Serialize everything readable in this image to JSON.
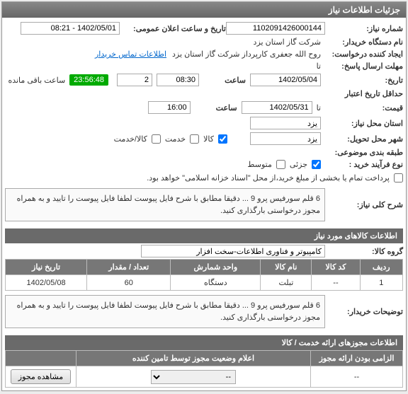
{
  "header": {
    "title": "جزئیات اطلاعات نیاز"
  },
  "info": {
    "req_no_label": "شماره نیاز:",
    "req_no": "1102091426000144",
    "announce_label": "تاریخ و ساعت اعلان عمومی:",
    "announce": "1402/05/01 - 08:21",
    "buyer_label": "نام دستگاه خریدار:",
    "buyer": "شرکت گاز استان یزد",
    "creator_label": "ایجاد کننده درخواست:",
    "creator": "روح الله جعفری کارپرداز شرکت گاز استان یزد",
    "contact_link": "اطلاعات تماس خریدار",
    "deadline_label": "مهلت ارسال پاسخ:",
    "deadline_word": "تا",
    "history_label": "تاریخ:",
    "deadline_date": "1402/05/04",
    "time_label": "ساعت",
    "deadline_time": "08:30",
    "days_remain": "2",
    "remain_badge": "23:56:48",
    "remain_text": "ساعت باقی مانده",
    "min_valid_label": "حداقل تاریخ اعتبار",
    "price_label": "قیمت:",
    "price_word": "تا",
    "valid_date": "1402/05/31",
    "valid_time": "16:00",
    "req_loc_label": "استان محل نیاز:",
    "req_loc": "یزد",
    "deliv_loc_label": "شهر محل تحویل:",
    "deliv_loc": "یزد",
    "cat_label": "طبقه بندی موضوعی:",
    "chk_goods": "کالا",
    "chk_service": "خدمت",
    "chk_goods_service": "کالا/خدمت",
    "proc_label": "نوع فرآیند خرید :",
    "chk_partial": "جزئی",
    "chk_mid": "متوسط",
    "pay_note": "پرداخت تمام یا بخشی از مبلغ خرید،از محل \"اسناد خزانه اسلامی\" خواهد بود."
  },
  "need": {
    "title_label": "شرح کلی نیاز:",
    "title_text": "6 قلم سورفیس پرو 9 ... دقیقا مطابق با شرح فایل پیوست لطفا فایل پیوست را تایید و به همراه مجوز درخواستی بارگذاری کنید."
  },
  "goods": {
    "section": "اطلاعات کالاهای مورد نیاز",
    "group_label": "گروه کالا:",
    "group_value": "کامپیوتر و فناوری اطلاعات-سخت افزار",
    "cols": {
      "row": "ردیف",
      "code": "کد کالا",
      "name": "نام کالا",
      "unit": "واحد شمارش",
      "qty": "تعداد / مقدار",
      "date": "تاریخ نیاز"
    },
    "rows": [
      {
        "row": "1",
        "code": "--",
        "name": "تبلت",
        "unit": "دستگاه",
        "qty": "60",
        "date": "1402/05/08"
      }
    ],
    "buyer_note_label": "توضیحات خریدار:",
    "buyer_note": "6 قلم سورفیس پرو 9 ... دقیقا مطابق با شرح فایل پیوست لطفا فایل پیوست را تایید و به همراه مجوز درخواستی بارگذاری کنید."
  },
  "permits": {
    "section": "اطلاعات مجوزهای ارائه خدمت / کالا",
    "cols": {
      "required": "الزامی بودن ارائه مجوز",
      "status": "اعلام وضعیت مجوز توسط تامین کننده",
      "action": ""
    },
    "row": {
      "required": "--",
      "status": "--",
      "btn": "مشاهده مجوز"
    }
  }
}
